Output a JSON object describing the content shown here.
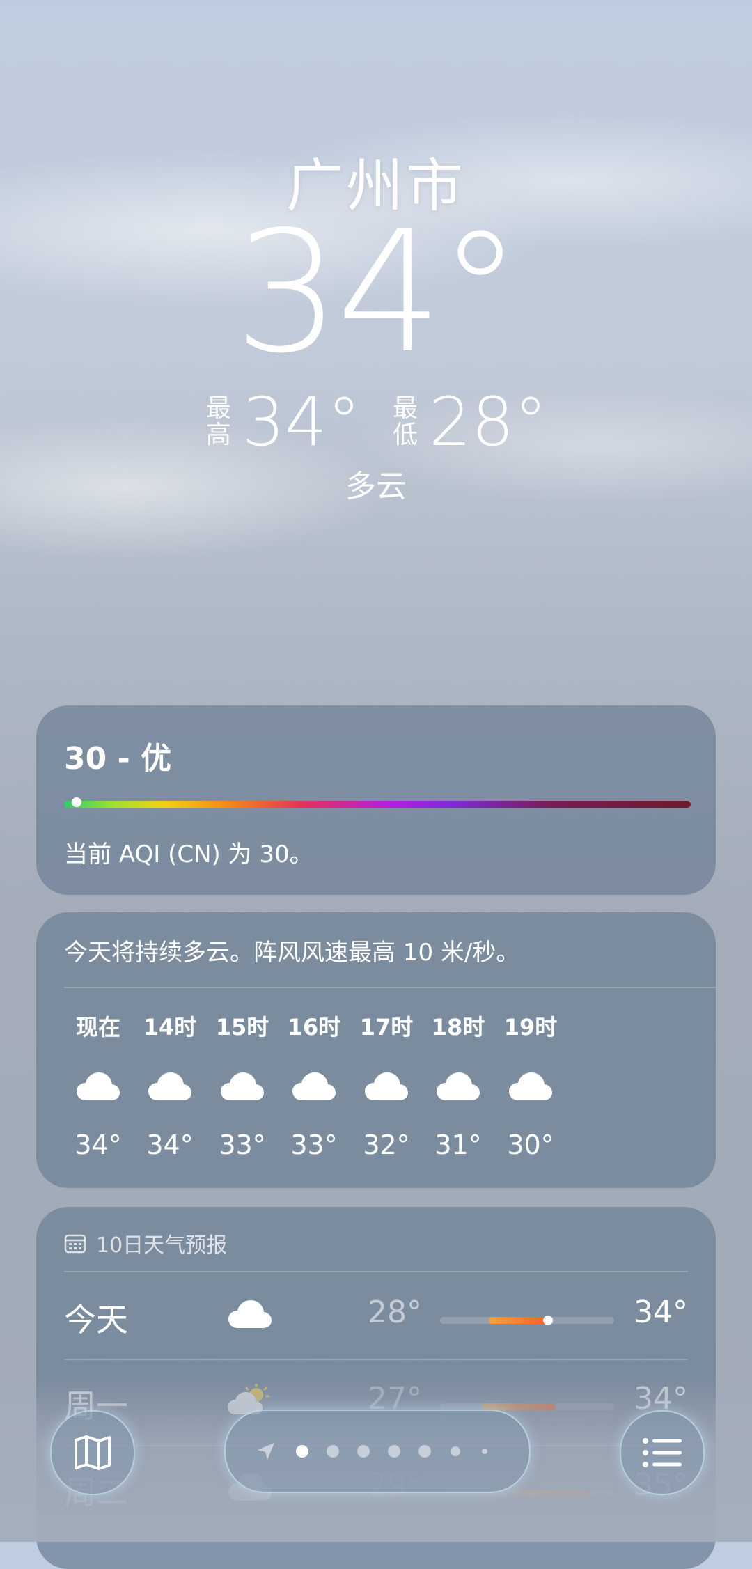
{
  "location": {
    "city": "广州市",
    "temperature": "34°",
    "high_label": "最高",
    "high": "34°",
    "low_label": "最低",
    "low": "28°",
    "condition": "多云"
  },
  "aqi": {
    "title": "30 - 优",
    "value": 30,
    "description": "当前 AQI (CN) 为 30。"
  },
  "hourly": {
    "summary": "今天将持续多云。阵风风速最高 10 米/秒。",
    "items": [
      {
        "time": "现在",
        "icon": "cloud-icon",
        "temp": "34°"
      },
      {
        "time": "14时",
        "icon": "cloud-icon",
        "temp": "34°"
      },
      {
        "time": "15时",
        "icon": "cloud-icon",
        "temp": "33°"
      },
      {
        "time": "16时",
        "icon": "cloud-icon",
        "temp": "33°"
      },
      {
        "time": "17时",
        "icon": "cloud-icon",
        "temp": "32°"
      },
      {
        "time": "18时",
        "icon": "cloud-icon",
        "temp": "31°"
      },
      {
        "time": "19时",
        "icon": "cloud-icon",
        "temp": "30°"
      }
    ]
  },
  "daily": {
    "header": "10日天气预报",
    "days": [
      {
        "name": "今天",
        "icon": "cloud-icon",
        "low": "28°",
        "high": "34°"
      },
      {
        "name": "周一",
        "icon": "partly-sunny-icon",
        "low": "27°",
        "high": "34°"
      },
      {
        "name": "周二",
        "icon": "cloud-icon",
        "low": "29°",
        "high": "35°"
      }
    ]
  },
  "pager": {
    "page_count": 7,
    "current_page": 1
  },
  "colors": {
    "card": "#6e8096",
    "temp_bar": "#f0622a"
  }
}
